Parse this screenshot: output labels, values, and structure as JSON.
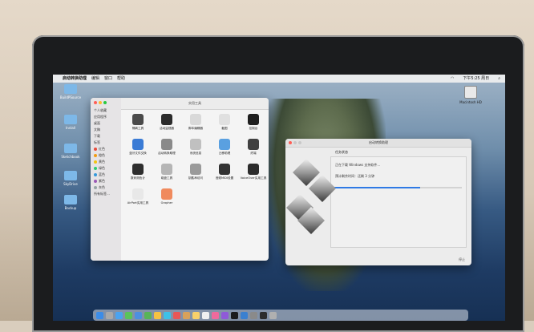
{
  "menubar": {
    "app": "启动转换助理",
    "items": [
      "编辑",
      "窗口",
      "帮助"
    ],
    "clock": "下午5:25 周日"
  },
  "desktop_icons": [
    "BuildPSource",
    "Install",
    "Sketchbook",
    "SkyDrive",
    "Backup"
  ],
  "drive_label": "Macintosh HD",
  "finder": {
    "title": "实用工具",
    "sidebar": [
      {
        "label": "个人收藏",
        "color": ""
      },
      {
        "label": "应用程序",
        "color": ""
      },
      {
        "label": "桌面",
        "color": ""
      },
      {
        "label": "文稿",
        "color": ""
      },
      {
        "label": "下载",
        "color": ""
      },
      {
        "label": "标签",
        "color": ""
      },
      {
        "label": "红色",
        "color": "#e74c3c"
      },
      {
        "label": "橙色",
        "color": "#f39c12"
      },
      {
        "label": "黄色",
        "color": "#f1c40f"
      },
      {
        "label": "绿色",
        "color": "#2ecc71"
      },
      {
        "label": "蓝色",
        "color": "#3498db"
      },
      {
        "label": "紫色",
        "color": "#9b59b6"
      },
      {
        "label": "灰色",
        "color": "#95a5a6"
      },
      {
        "label": "所有标签…",
        "color": ""
      }
    ],
    "apps": [
      {
        "label": "隔离工具",
        "color": "#4a4a4a"
      },
      {
        "label": "活动监视器",
        "color": "#2b2b2b"
      },
      {
        "label": "脚本编辑器",
        "color": "#d9d9d9"
      },
      {
        "label": "截图",
        "color": "#e0e0e0"
      },
      {
        "label": "控制台",
        "color": "#1f1f1f"
      },
      {
        "label": "蓝牙文件交换",
        "color": "#3a7bd5"
      },
      {
        "label": "启动转换助理",
        "color": "#8a8a8a"
      },
      {
        "label": "系统信息",
        "color": "#c0c0c0"
      },
      {
        "label": "迁移助理",
        "color": "#5aa0e0"
      },
      {
        "label": "终端",
        "color": "#404040"
      },
      {
        "label": "数码测色计",
        "color": "#2e2e2e"
      },
      {
        "label": "磁盘工具",
        "color": "#b5b5b5"
      },
      {
        "label": "钥匙串访问",
        "color": "#9a9a9a"
      },
      {
        "label": "音频MIDI设置",
        "color": "#333333"
      },
      {
        "label": "VoiceOver实用工具",
        "color": "#2c2c2c"
      },
      {
        "label": "AirPort实用工具",
        "color": "#e8e8e8"
      },
      {
        "label": "Grapher",
        "color": "#f08a5d"
      }
    ]
  },
  "bootcamp": {
    "window_title": "启动转换助理",
    "heading": "任务状态",
    "downloading": "正在下载 Windows 支持软件…",
    "remaining": "预计剩余时间：还剩 3 分钟",
    "progress": 0.68,
    "button": "停止"
  }
}
